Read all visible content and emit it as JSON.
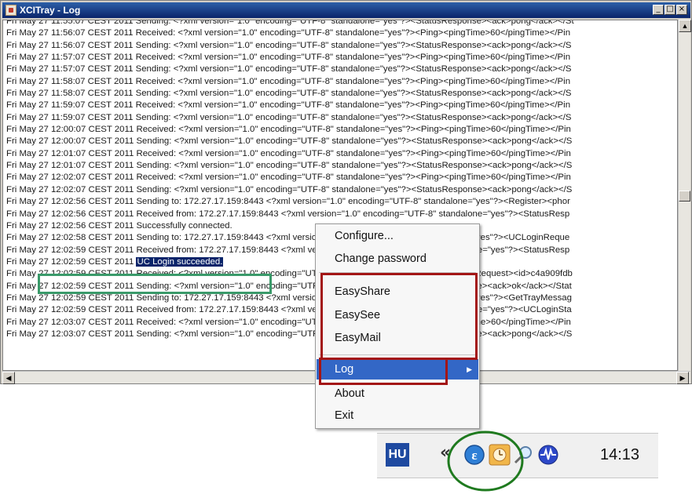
{
  "window": {
    "title": "XCITray - Log"
  },
  "log_lines": [
    "Fri May 27 11:55:07 CEST 2011 Sending: <?xml version=\"1.0\" encoding=\"UTF-8\" standalone=\"yes\"?><StatusResponse><ack>pong</ack></St",
    "Fri May 27 11:56:07 CEST 2011 Received: <?xml version=\"1.0\" encoding=\"UTF-8\" standalone=\"yes\"?><Ping><pingTime>60</pingTime></Pin",
    "Fri May 27 11:56:07 CEST 2011 Sending: <?xml version=\"1.0\" encoding=\"UTF-8\" standalone=\"yes\"?><StatusResponse><ack>pong</ack></S",
    "Fri May 27 11:57:07 CEST 2011 Received: <?xml version=\"1.0\" encoding=\"UTF-8\" standalone=\"yes\"?><Ping><pingTime>60</pingTime></Pin",
    "Fri May 27 11:57:07 CEST 2011 Sending: <?xml version=\"1.0\" encoding=\"UTF-8\" standalone=\"yes\"?><StatusResponse><ack>pong</ack></S",
    "Fri May 27 11:58:07 CEST 2011 Received: <?xml version=\"1.0\" encoding=\"UTF-8\" standalone=\"yes\"?><Ping><pingTime>60</pingTime></Pin",
    "Fri May 27 11:58:07 CEST 2011 Sending: <?xml version=\"1.0\" encoding=\"UTF-8\" standalone=\"yes\"?><StatusResponse><ack>pong</ack></S",
    "Fri May 27 11:59:07 CEST 2011 Received: <?xml version=\"1.0\" encoding=\"UTF-8\" standalone=\"yes\"?><Ping><pingTime>60</pingTime></Pin",
    "Fri May 27 11:59:07 CEST 2011 Sending: <?xml version=\"1.0\" encoding=\"UTF-8\" standalone=\"yes\"?><StatusResponse><ack>pong</ack></S",
    "Fri May 27 12:00:07 CEST 2011 Received: <?xml version=\"1.0\" encoding=\"UTF-8\" standalone=\"yes\"?><Ping><pingTime>60</pingTime></Pin",
    "Fri May 27 12:00:07 CEST 2011 Sending: <?xml version=\"1.0\" encoding=\"UTF-8\" standalone=\"yes\"?><StatusResponse><ack>pong</ack></S",
    "Fri May 27 12:01:07 CEST 2011 Received: <?xml version=\"1.0\" encoding=\"UTF-8\" standalone=\"yes\"?><Ping><pingTime>60</pingTime></Pin",
    "Fri May 27 12:01:07 CEST 2011 Sending: <?xml version=\"1.0\" encoding=\"UTF-8\" standalone=\"yes\"?><StatusResponse><ack>pong</ack></S",
    "Fri May 27 12:02:07 CEST 2011 Received: <?xml version=\"1.0\" encoding=\"UTF-8\" standalone=\"yes\"?><Ping><pingTime>60</pingTime></Pin",
    "Fri May 27 12:02:07 CEST 2011 Sending: <?xml version=\"1.0\" encoding=\"UTF-8\" standalone=\"yes\"?><StatusResponse><ack>pong</ack></S",
    "Fri May 27 12:02:56 CEST 2011 Sending to: 172.27.17.159:8443 <?xml version=\"1.0\" encoding=\"UTF-8\" standalone=\"yes\"?><Register><phor",
    "Fri May 27 12:02:56 CEST 2011 Received from: 172.27.17.159:8443 <?xml version=\"1.0\" encoding=\"UTF-8\" standalone=\"yes\"?><StatusResp",
    "Fri May 27 12:02:56 CEST 2011 Successfully connected.",
    "Fri May 27 12:02:58 CEST 2011 Sending to: 172.27.17.159:8443 <?xml version=\"1.0\" encoding=\"UTF-8\" standalone=\"yes\"?><UCLoginReque",
    "Fri May 27 12:02:59 CEST 2011 Received from: 172.27.17.159:8443 <?xml version=\"1.0\" encoding=\"UTF-8\" standalone=\"yes\"?><StatusResp",
    "Fri May 27 12:02:59 CEST 2011 ",
    "Fri May 27 12:02:59 CEST 2011 Received: <?xml version=\"1.0\" encoding=\"UTF-8\" standalone=\"yes\"?><TrayMessageRequest><id>c4a909fdb",
    "Fri May 27 12:02:59 CEST 2011 Sending: <?xml version=\"1.0\" encoding=\"UTF-8\" standalone=\"yes\"?><StatusResponse><ack>ok</ack></Stat",
    "Fri May 27 12:02:59 CEST 2011 Sending to: 172.27.17.159:8443 <?xml version=\"1.0\" encoding=\"UTF-8\" standalone=\"yes\"?><GetTrayMessag",
    "Fri May 27 12:02:59 CEST 2011 Received from: 172.27.17.159:8443 <?xml version=\"1.0\" encoding=\"UTF-8\" standalone=\"yes\"?><UCLoginSta",
    "Fri May 27 12:03:07 CEST 2011 Received: <?xml version=\"1.0\" encoding=\"UTF-8\" standalone=\"yes\"?><Ping><pingTime>60</pingTime></Pin",
    "Fri May 27 12:03:07 CEST 2011 Sending: <?xml version=\"1.0\" encoding=\"UTF-8\" standalone=\"yes\"?><StatusResponse><ack>pong</ack></S"
  ],
  "highlighted_text": "UC Login succeeded.",
  "menu": {
    "configure": "Configure...",
    "change_password": "Change password",
    "easyshare": "EasyShare",
    "easysee": "EasySee",
    "easymail": "EasyMail",
    "log": "Log",
    "about": "About",
    "exit": "Exit"
  },
  "taskbar": {
    "language": "HU",
    "clock": "14:13"
  },
  "icons": {
    "expand": "chevron-left-icon",
    "easy": "easy-e-icon",
    "clock_app": "clock-icon",
    "search": "magnifier-icon",
    "network": "network-icon"
  },
  "colors": {
    "annotation_red": "#a31515",
    "annotation_green_box": "#3a9a6a",
    "annotation_green_circle": "#1f7a1f",
    "menu_selection": "#3367c6",
    "title_bar": "#0a246a"
  }
}
